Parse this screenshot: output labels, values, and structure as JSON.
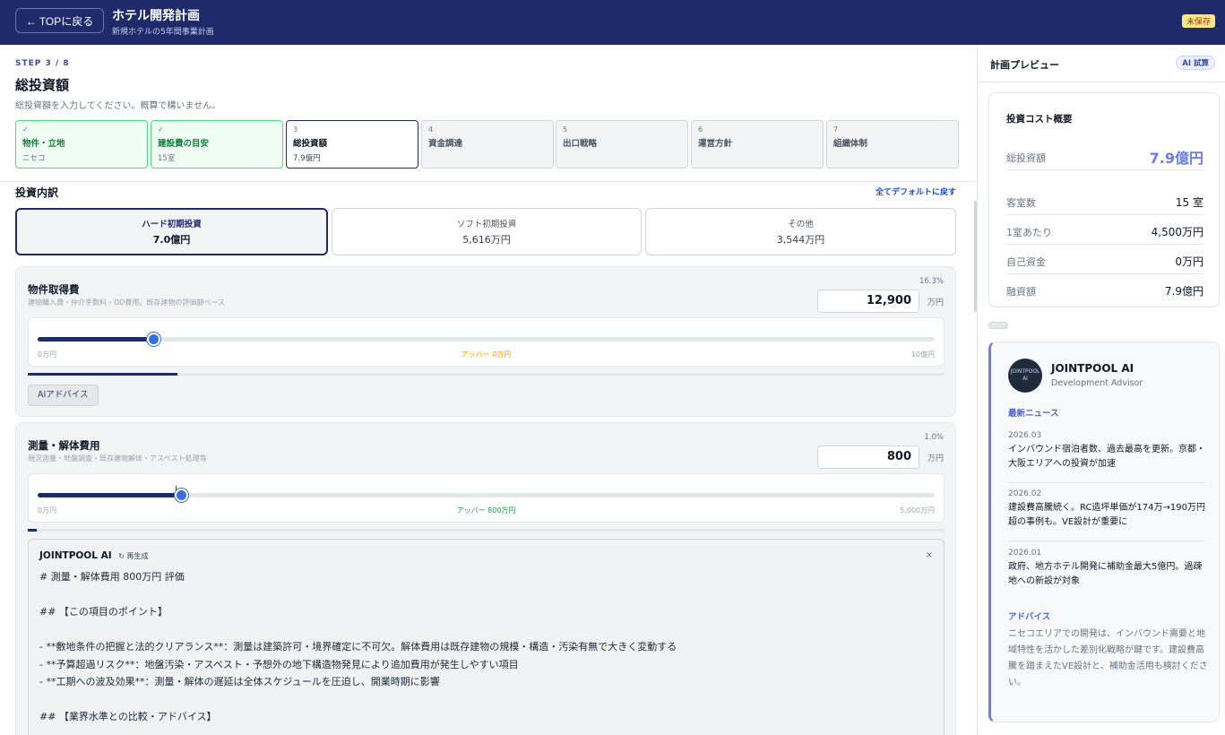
{
  "header": {
    "back_label": "← TOPに戻る",
    "title": "ホテル開発計画",
    "subtitle": "新規ホテルの5年間事業計画",
    "status_badge": "未保存"
  },
  "main": {
    "step_label": "STEP 3 / 8",
    "title": "総投資額",
    "description": "総投資額を入力してください。概算で構いません。",
    "steps": [
      {
        "num": "✓",
        "label": "物件・立地",
        "value": "ニセコ",
        "state": "done"
      },
      {
        "num": "✓",
        "label": "建設費の目安",
        "value": "15室",
        "state": "done"
      },
      {
        "num": "3",
        "label": "総投資額",
        "value": "7.9億円",
        "state": "current"
      },
      {
        "num": "4",
        "label": "資金調達",
        "value": "",
        "state": "todo"
      },
      {
        "num": "5",
        "label": "出口戦略",
        "value": "",
        "state": "todo"
      },
      {
        "num": "6",
        "label": "運営方針",
        "value": "",
        "state": "todo"
      },
      {
        "num": "7",
        "label": "組織体制",
        "value": "",
        "state": "todo"
      }
    ],
    "section_title": "投資内訳",
    "reset_label": "全てデフォルトに戻す",
    "tabs": [
      {
        "label": "ハード初期投資",
        "value": "7.0億円"
      },
      {
        "label": "ソフト初期投資",
        "value": "5,616万円"
      },
      {
        "label": "その他",
        "value": "3,544万円"
      }
    ],
    "items": [
      {
        "title": "物件取得費",
        "description": "建物購入費・仲介手数料・DD費用。既存建物の評価額ベース",
        "percent": "16.3%",
        "amount": "12,900",
        "unit": "万円",
        "slider_min": "0万円",
        "slider_max": "10億円",
        "slider_mid": "アッパー 0万円",
        "slider_mid_color": "#f59e0b",
        "slider_fraction": 0.129,
        "progress_fraction": 0.163,
        "ai_button": "AIアドバイス"
      },
      {
        "title": "測量・解体費用",
        "description": "現況測量・地盤調査・既存建物解体・アスベスト処理等",
        "percent": "1.0%",
        "amount": "800",
        "unit": "万円",
        "slider_min": "0万円",
        "slider_max": "5,000万円",
        "slider_mid": "アッパー 800万円",
        "slider_mid_color": "#16a34a",
        "slider_fraction": 0.16,
        "progress_fraction": 0.01,
        "ai_panel": {
          "title": "JOINTPOOL AI",
          "regenerate": "↻ 再生成",
          "close": "×",
          "lines": [
            "# 測量・解体費用 800万円 評価",
            "",
            "## 【この項目のポイント】",
            "",
            "- **敷地条件の把握と法的クリアランス**：測量は建築許可・境界確定に不可欠。解体費用は既存建物の規模・構造・汚染有無で大きく変動する",
            "- **予算超過リスク**：地盤汚染・アスベスト・予想外の地下構造物発見により追加費用が発生しやすい項目",
            "- **工期への波及効果**：測量・解体の遅延は全体スケジュールを圧迫し、開業時期に影響",
            "",
            "## 【業界水準との比較・アドバイス】"
          ]
        }
      }
    ]
  },
  "sidebar": {
    "title": "計画プレビュー",
    "ai_badge": "AI 試算",
    "summary": {
      "title": "投資コスト概要",
      "rows": [
        {
          "label": "総投資額",
          "value": "7.9億円"
        },
        {
          "label": "客室数",
          "value": "15 室"
        },
        {
          "label": "1室あたり",
          "value": "4,500万円"
        },
        {
          "label": "自己資金",
          "value": "0万円"
        },
        {
          "label": "融資額",
          "value": "7.9億円"
        }
      ]
    },
    "advisor": {
      "avatar_text": "JOINTPOOL AI",
      "name": "JOINTPOOL AI",
      "role": "Development Advisor",
      "news_heading": "最新ニュース",
      "news": [
        {
          "date": "2026.03",
          "text": "インバウンド宿泊者数、過去最高を更新。京都・大阪エリアへの投資が加速"
        },
        {
          "date": "2026.02",
          "text": "建設費高騰続く。RC造坪単価が174万→190万円超の事例も。VE設計が重要に"
        },
        {
          "date": "2026.01",
          "text": "政府、地方ホテル開発に補助金最大5億円。過疎地への新設が対象"
        }
      ],
      "advice_heading": "アドバイス",
      "advice_text": "ニセコエリアでの開発は、インバウンド需要と地域特性を活かした差別化戦略が鍵です。建設費高騰を踏まえたVE設計と、補助金活用も検討ください。"
    }
  },
  "colors": {
    "header_bg": "#1f2a6b",
    "accent": "#3b6fe0",
    "done": "#16a34a"
  }
}
